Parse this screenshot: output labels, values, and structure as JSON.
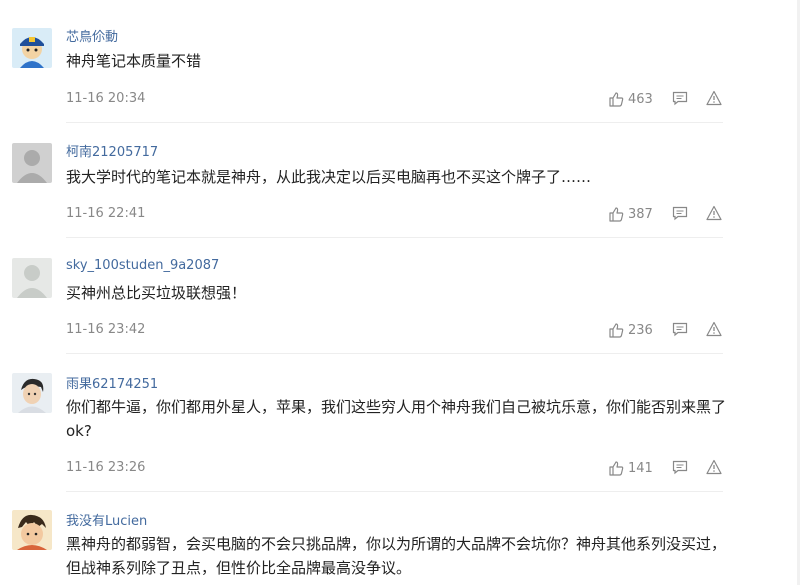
{
  "comments": [
    {
      "user": "芯鳥伱動",
      "text": "神舟笔记本质量不错",
      "time": "11-16 20:34",
      "likes": "463"
    },
    {
      "user": "柯南21205717",
      "text": "我大学时代的笔记本就是神舟，从此我决定以后买电脑再也不买这个牌子了……",
      "time": "11-16 22:41",
      "likes": "387"
    },
    {
      "user": "sky_100studen_9a2087",
      "text": "买神州总比买垃圾联想强！",
      "time": "11-16 23:42",
      "likes": "236"
    },
    {
      "user": "雨果62174251",
      "text": "你们都牛逼，你们都用外星人，苹果，我们这些穷人用个神舟我们自己被坑乐意，你们能否别来黑了ok?",
      "time": "11-16 23:26",
      "likes": "141"
    },
    {
      "user": "我没有Lucien",
      "text": "黑神舟的都弱智，会买电脑的不会只挑品牌，你以为所谓的大品牌不会坑你？神舟其他系列没买过，但战神系列除了丑点，但性价比全品牌最高没争议。"
    }
  ],
  "icons": {
    "like": "thumbs-up-icon",
    "reply": "speech-bubble-icon",
    "report": "warning-triangle-icon"
  },
  "colors": {
    "username": "#436a9e",
    "meta": "#888888",
    "text": "#222222"
  }
}
